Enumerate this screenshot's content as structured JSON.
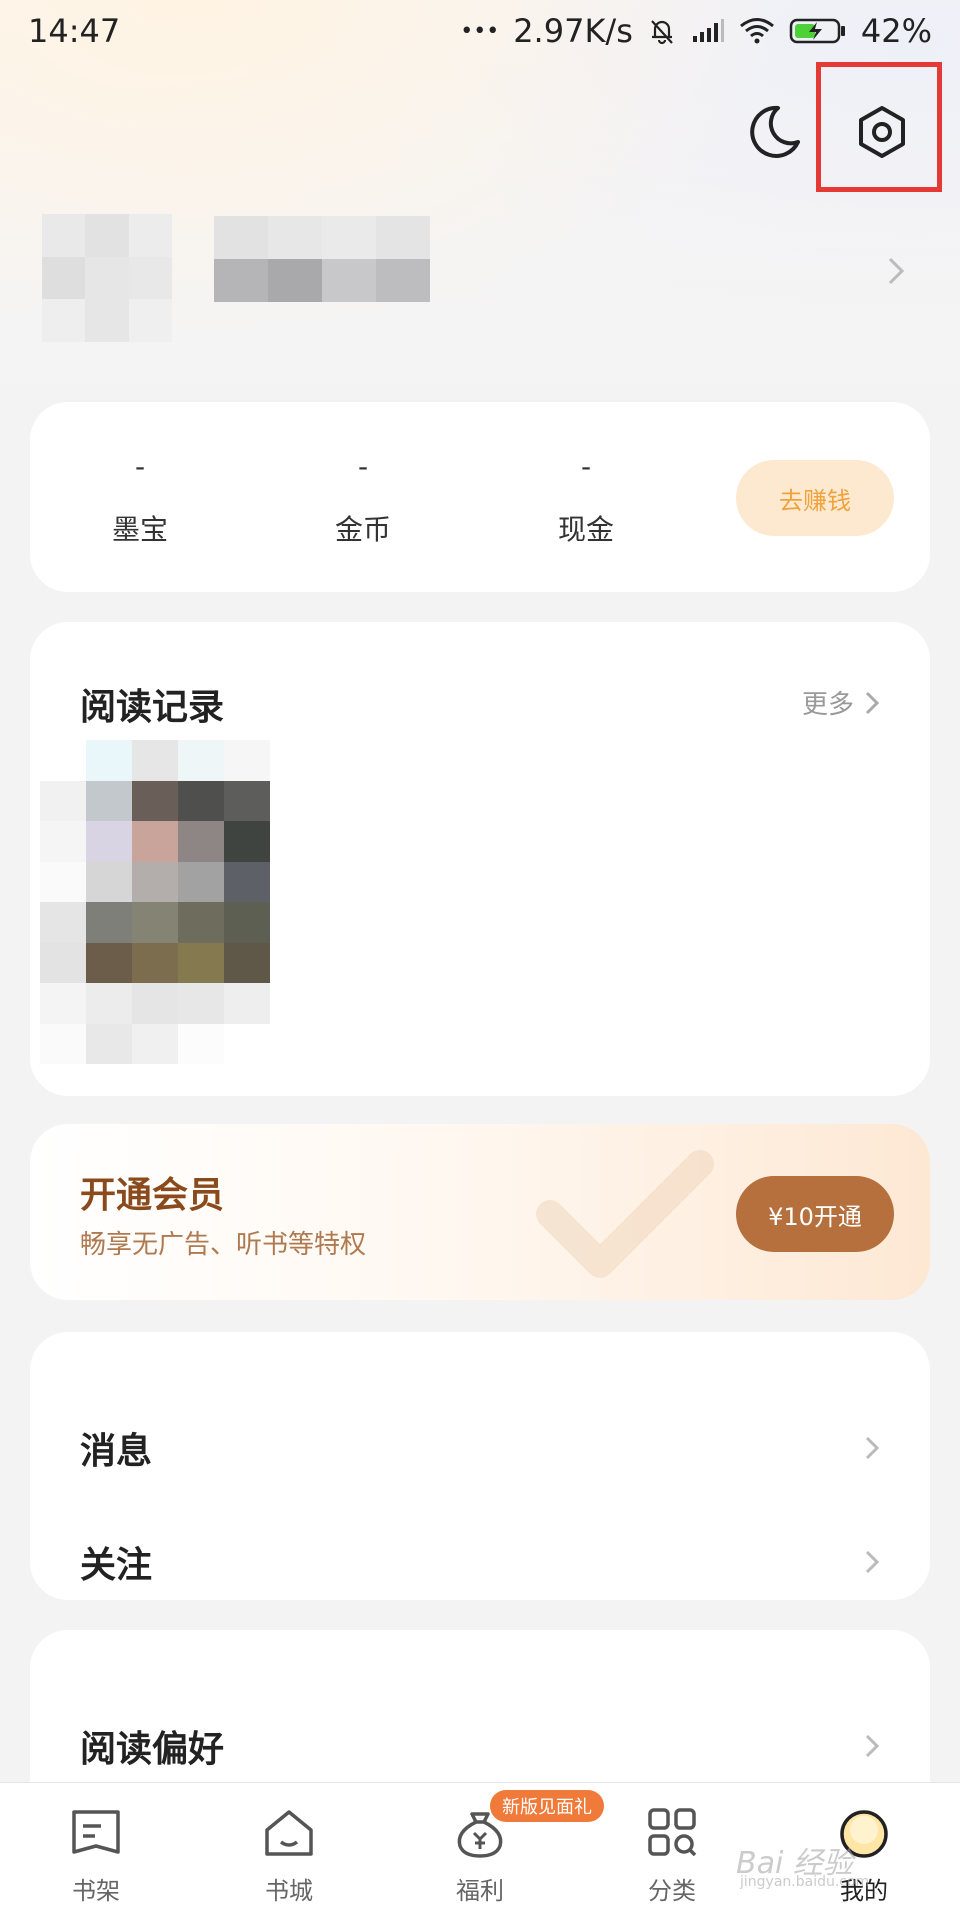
{
  "status_bar": {
    "time": "14:47",
    "dots": "•••",
    "speed": "2.97K/s",
    "battery": "42%"
  },
  "wallet": {
    "items": [
      {
        "value": "-",
        "label": "墨宝"
      },
      {
        "value": "-",
        "label": "金币"
      },
      {
        "value": "-",
        "label": "现金"
      }
    ],
    "earn_button": "去赚钱"
  },
  "history": {
    "title": "阅读记录",
    "more": "更多"
  },
  "vip": {
    "title": "开通会员",
    "subtitle": "畅享无广告、听书等特权",
    "button": "¥10开通"
  },
  "menu": {
    "messages": "消息",
    "follow": "关注",
    "reading_pref": "阅读偏好"
  },
  "tabbar": {
    "badge": "新版见面礼",
    "tabs": [
      {
        "label": "书架",
        "icon": "bookshelf-icon"
      },
      {
        "label": "书城",
        "icon": "bookstore-icon"
      },
      {
        "label": "福利",
        "icon": "welfare-bag-icon"
      },
      {
        "label": "分类",
        "icon": "category-grid-icon"
      },
      {
        "label": "我的",
        "icon": "profile-icon"
      }
    ]
  },
  "watermark": {
    "text": "Bai 经验",
    "sub": "jingyan.baidu.com"
  },
  "colors": {
    "accent_orange": "#f0a23c",
    "vip_brown": "#b5703e",
    "highlight_red": "#e53935"
  }
}
